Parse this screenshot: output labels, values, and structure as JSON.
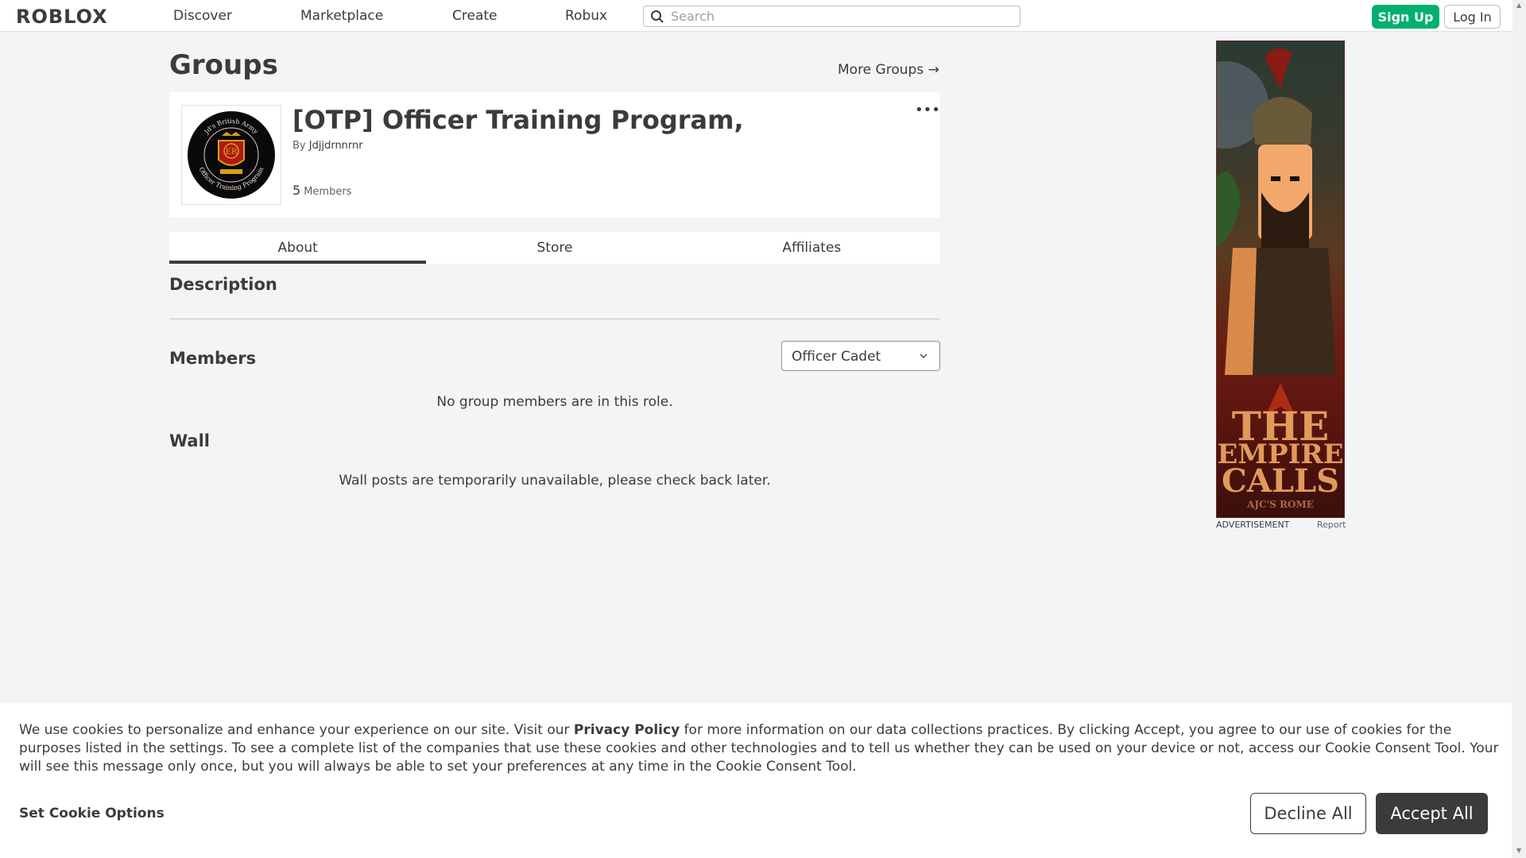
{
  "header": {
    "logo": "ROBLOX",
    "nav": [
      "Discover",
      "Marketplace",
      "Create",
      "Robux"
    ],
    "search_placeholder": "Search",
    "signup_label": "Sign Up",
    "login_label": "Log In"
  },
  "page": {
    "title": "Groups",
    "more_groups_label": "More Groups →"
  },
  "group": {
    "name": "[OTP] Officer Training Program,",
    "by_prefix": "By",
    "owner": "Jdjjdrnnrnr",
    "member_count": "5",
    "members_label": "Members",
    "emblem_top_text": "Jd's British Army",
    "emblem_bottom_text": "Officer Training Program",
    "emblem_center": "ER"
  },
  "tabs": [
    "About",
    "Store",
    "Affiliates"
  ],
  "active_tab": "About",
  "about": {
    "description_heading": "Description",
    "members_heading": "Members",
    "role_selected": "Officer Cadet",
    "no_members_msg": "No group members are in this role.",
    "wall_heading": "Wall",
    "wall_msg": "Wall posts are temporarily unavailable, please check back later."
  },
  "ad": {
    "line1": "THE",
    "line2": "EMPIRE",
    "line3": "CALLS",
    "line4": "AJC'S ROME",
    "label": "ADVERTISEMENT",
    "report": "Report"
  },
  "cookie": {
    "text_before": "We use cookies to personalize and enhance your experience on our site. Visit our ",
    "privacy_link": "Privacy Policy",
    "text_after": " for more information on our data collections practices. By clicking Accept, you agree to our use of cookies for the purposes listed in the settings. To see a complete list of the companies that use these cookies and other technologies and to tell us whether they can be used on your device or not, access our Cookie Consent Tool. Your will see this message only once, but you will always be able to set your preferences at any time in the Cookie Consent Tool.",
    "options_label": "Set Cookie Options",
    "decline_label": "Decline All",
    "accept_label": "Accept All"
  },
  "colors": {
    "accent_green": "#00b06f",
    "text_dark": "#393b3d",
    "background": "#f2f4f5"
  }
}
